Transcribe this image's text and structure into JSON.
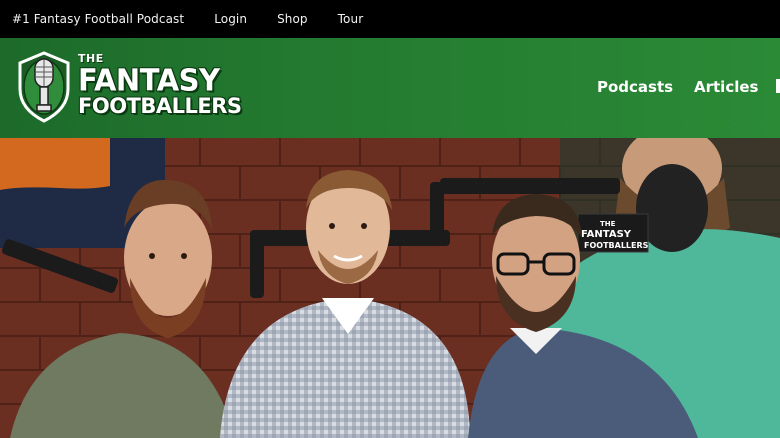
{
  "topbar": {
    "items": [
      {
        "label": "#1 Fantasy Football Podcast"
      },
      {
        "label": "Login"
      },
      {
        "label": "Shop"
      },
      {
        "label": "Tour"
      }
    ]
  },
  "header": {
    "logo": {
      "the": "THE",
      "line1": "FANTASY",
      "line2": "FOOTBALLERS",
      "icon": "microphone-football-shield-icon"
    },
    "nav": [
      {
        "label": "Podcasts"
      },
      {
        "label": "Articles"
      }
    ]
  },
  "hero": {
    "mic_flag_text_1": "THE",
    "mic_flag_text_2": "FANTASY",
    "mic_flag_text_3": "FOOTBALLERS"
  },
  "colors": {
    "header_green": "#237a30",
    "topbar_bg": "#000000",
    "text_white": "#ffffff"
  }
}
